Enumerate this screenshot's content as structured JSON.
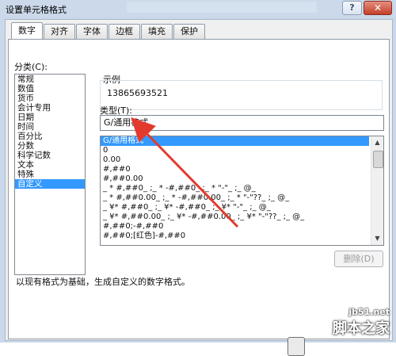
{
  "window": {
    "title": "设置单元格格式",
    "help_label": "?",
    "close_label": "✕"
  },
  "tabs": [
    "数字",
    "对齐",
    "字体",
    "边框",
    "填充",
    "保护"
  ],
  "category": {
    "label": "分类(C):",
    "items": [
      "常规",
      "数值",
      "货币",
      "会计专用",
      "日期",
      "时间",
      "百分比",
      "分数",
      "科学记数",
      "文本",
      "特殊",
      "自定义"
    ],
    "selected_index": 11
  },
  "sample": {
    "label": "示例",
    "value": "13865693521"
  },
  "type": {
    "label": "类型(T):",
    "value": "G/通用格式"
  },
  "formats": {
    "items": [
      "G/通用格式",
      "0",
      "0.00",
      "#,##0",
      "#,##0.00",
      "_ * #,##0_ ;_ * -#,##0_ ;_ * \"-\"_ ;_ @_",
      "_ * #,##0.00_ ;_ * -#,##0.00_ ;_ * \"-\"??_ ;_ @_",
      "_ ¥* #,##0_ ;_ ¥* -#,##0_ ;_ ¥* \"-\"_ ;_ @_",
      "_ ¥* #,##0.00_ ;_ ¥* -#,##0.00_ ;_ ¥* \"-\"??_ ;_ @_",
      "#,##0;-#,##0",
      "#,##0;[红色]-#,##0"
    ],
    "selected_index": 0
  },
  "delete_label": "删除(D)",
  "description": "以现有格式为基础，生成自定义的数字格式。",
  "watermark": {
    "url": "jb51.net",
    "name": "脚本之家"
  },
  "colors": {
    "selection": "#3399ff",
    "annotation_arrow": "#e23b2e"
  }
}
